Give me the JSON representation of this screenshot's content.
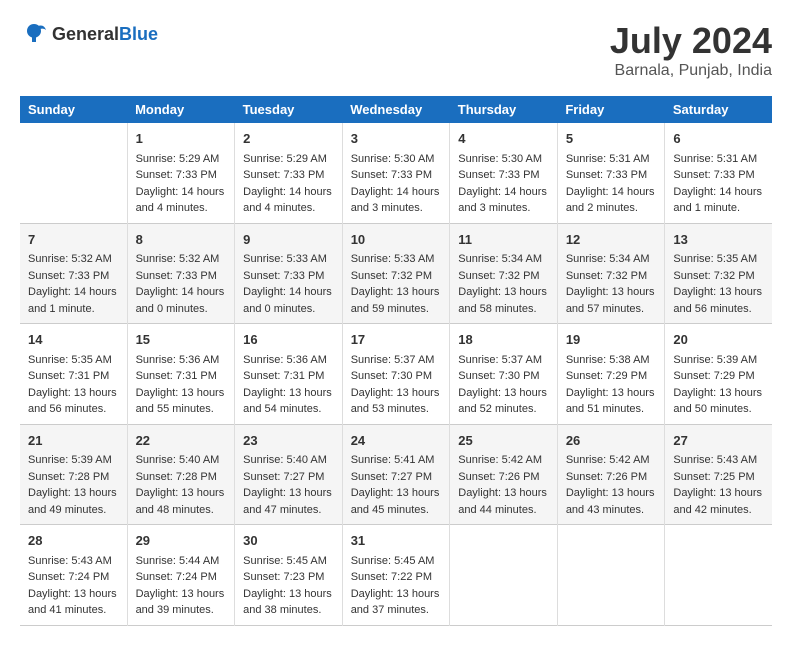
{
  "header": {
    "logo": {
      "general": "General",
      "blue": "Blue"
    },
    "title": "July 2024",
    "subtitle": "Barnala, Punjab, India"
  },
  "calendar": {
    "days_of_week": [
      "Sunday",
      "Monday",
      "Tuesday",
      "Wednesday",
      "Thursday",
      "Friday",
      "Saturday"
    ],
    "weeks": [
      [
        {
          "day": "",
          "content": ""
        },
        {
          "day": "1",
          "content": "Sunrise: 5:29 AM\nSunset: 7:33 PM\nDaylight: 14 hours\nand 4 minutes."
        },
        {
          "day": "2",
          "content": "Sunrise: 5:29 AM\nSunset: 7:33 PM\nDaylight: 14 hours\nand 4 minutes."
        },
        {
          "day": "3",
          "content": "Sunrise: 5:30 AM\nSunset: 7:33 PM\nDaylight: 14 hours\nand 3 minutes."
        },
        {
          "day": "4",
          "content": "Sunrise: 5:30 AM\nSunset: 7:33 PM\nDaylight: 14 hours\nand 3 minutes."
        },
        {
          "day": "5",
          "content": "Sunrise: 5:31 AM\nSunset: 7:33 PM\nDaylight: 14 hours\nand 2 minutes."
        },
        {
          "day": "6",
          "content": "Sunrise: 5:31 AM\nSunset: 7:33 PM\nDaylight: 14 hours\nand 1 minute."
        }
      ],
      [
        {
          "day": "7",
          "content": "Sunrise: 5:32 AM\nSunset: 7:33 PM\nDaylight: 14 hours\nand 1 minute."
        },
        {
          "day": "8",
          "content": "Sunrise: 5:32 AM\nSunset: 7:33 PM\nDaylight: 14 hours\nand 0 minutes."
        },
        {
          "day": "9",
          "content": "Sunrise: 5:33 AM\nSunset: 7:33 PM\nDaylight: 14 hours\nand 0 minutes."
        },
        {
          "day": "10",
          "content": "Sunrise: 5:33 AM\nSunset: 7:32 PM\nDaylight: 13 hours\nand 59 minutes."
        },
        {
          "day": "11",
          "content": "Sunrise: 5:34 AM\nSunset: 7:32 PM\nDaylight: 13 hours\nand 58 minutes."
        },
        {
          "day": "12",
          "content": "Sunrise: 5:34 AM\nSunset: 7:32 PM\nDaylight: 13 hours\nand 57 minutes."
        },
        {
          "day": "13",
          "content": "Sunrise: 5:35 AM\nSunset: 7:32 PM\nDaylight: 13 hours\nand 56 minutes."
        }
      ],
      [
        {
          "day": "14",
          "content": "Sunrise: 5:35 AM\nSunset: 7:31 PM\nDaylight: 13 hours\nand 56 minutes."
        },
        {
          "day": "15",
          "content": "Sunrise: 5:36 AM\nSunset: 7:31 PM\nDaylight: 13 hours\nand 55 minutes."
        },
        {
          "day": "16",
          "content": "Sunrise: 5:36 AM\nSunset: 7:31 PM\nDaylight: 13 hours\nand 54 minutes."
        },
        {
          "day": "17",
          "content": "Sunrise: 5:37 AM\nSunset: 7:30 PM\nDaylight: 13 hours\nand 53 minutes."
        },
        {
          "day": "18",
          "content": "Sunrise: 5:37 AM\nSunset: 7:30 PM\nDaylight: 13 hours\nand 52 minutes."
        },
        {
          "day": "19",
          "content": "Sunrise: 5:38 AM\nSunset: 7:29 PM\nDaylight: 13 hours\nand 51 minutes."
        },
        {
          "day": "20",
          "content": "Sunrise: 5:39 AM\nSunset: 7:29 PM\nDaylight: 13 hours\nand 50 minutes."
        }
      ],
      [
        {
          "day": "21",
          "content": "Sunrise: 5:39 AM\nSunset: 7:28 PM\nDaylight: 13 hours\nand 49 minutes."
        },
        {
          "day": "22",
          "content": "Sunrise: 5:40 AM\nSunset: 7:28 PM\nDaylight: 13 hours\nand 48 minutes."
        },
        {
          "day": "23",
          "content": "Sunrise: 5:40 AM\nSunset: 7:27 PM\nDaylight: 13 hours\nand 47 minutes."
        },
        {
          "day": "24",
          "content": "Sunrise: 5:41 AM\nSunset: 7:27 PM\nDaylight: 13 hours\nand 45 minutes."
        },
        {
          "day": "25",
          "content": "Sunrise: 5:42 AM\nSunset: 7:26 PM\nDaylight: 13 hours\nand 44 minutes."
        },
        {
          "day": "26",
          "content": "Sunrise: 5:42 AM\nSunset: 7:26 PM\nDaylight: 13 hours\nand 43 minutes."
        },
        {
          "day": "27",
          "content": "Sunrise: 5:43 AM\nSunset: 7:25 PM\nDaylight: 13 hours\nand 42 minutes."
        }
      ],
      [
        {
          "day": "28",
          "content": "Sunrise: 5:43 AM\nSunset: 7:24 PM\nDaylight: 13 hours\nand 41 minutes."
        },
        {
          "day": "29",
          "content": "Sunrise: 5:44 AM\nSunset: 7:24 PM\nDaylight: 13 hours\nand 39 minutes."
        },
        {
          "day": "30",
          "content": "Sunrise: 5:45 AM\nSunset: 7:23 PM\nDaylight: 13 hours\nand 38 minutes."
        },
        {
          "day": "31",
          "content": "Sunrise: 5:45 AM\nSunset: 7:22 PM\nDaylight: 13 hours\nand 37 minutes."
        },
        {
          "day": "",
          "content": ""
        },
        {
          "day": "",
          "content": ""
        },
        {
          "day": "",
          "content": ""
        }
      ]
    ]
  }
}
